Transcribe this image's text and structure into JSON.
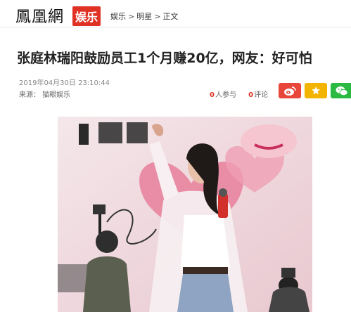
{
  "header": {
    "logo_text": "鳳凰網",
    "logo_badge": "娱乐",
    "breadcrumb": [
      "娱乐",
      "明星",
      "正文"
    ],
    "breadcrumb_separator": ">"
  },
  "article": {
    "title": "张庭林瑞阳鼓励员工1个月赚20亿，网友：好可怕",
    "datetime": "2019年04月30日 23:10:44",
    "source": "来源：  猫眼娱乐",
    "participants_count": "0",
    "participants_label": "人参与",
    "comments_count": "0",
    "comments_label": "评论"
  },
  "share": {
    "buttons": [
      {
        "icon": "weibo-icon",
        "color": "#e8463b"
      },
      {
        "icon": "qzone-star-icon",
        "color": "#f2b400"
      },
      {
        "icon": "wechat-icon",
        "color": "#2bba41"
      }
    ]
  },
  "colors": {
    "accent": "#e03224"
  }
}
